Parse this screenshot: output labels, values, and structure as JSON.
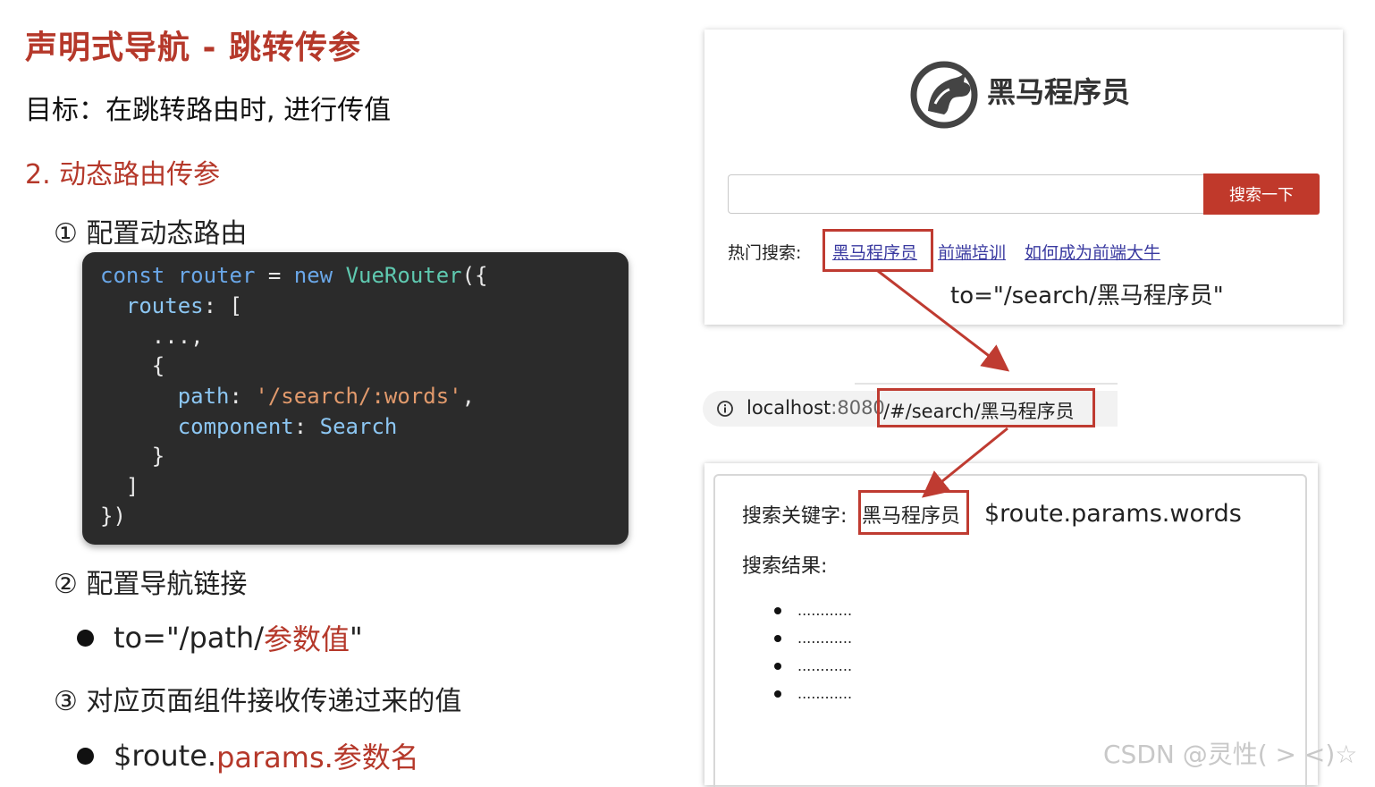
{
  "slide": {
    "title": "声明式导航 - 跳转传参",
    "goal": "目标：在跳转路由时, 进行传值",
    "section": "2.  动态路由传参",
    "step1": "① 配置动态路由",
    "step2": "② 配置导航链接",
    "step3": "③ 对应页面组件接收传递过来的值",
    "bullet1": {
      "prefix": "to=\"/path/",
      "highlight": "参数值",
      "suffix": "\""
    },
    "bullet2": {
      "prefix": "$route.",
      "highlight": "params.参数名"
    }
  },
  "code": {
    "line1": {
      "kw1": "const",
      "var": "router",
      "eq": " = ",
      "kw2": "new",
      "cls": "VueRouter",
      "tail": "({"
    },
    "line2": {
      "prop": "routes",
      "tail": ": ["
    },
    "line3": "...,",
    "line4": "{",
    "line5": {
      "prop": "path",
      "colon": ": ",
      "str": "'/search/:words'",
      "tail": ","
    },
    "line6": {
      "prop": "component",
      "colon": ": ",
      "val": "Search"
    },
    "line7": "}",
    "line8": "]",
    "line9": "})"
  },
  "browser": {
    "brand": "黑马程序员",
    "search_input_value": "",
    "search_button": "搜索一下",
    "hot_label": "热门搜索:",
    "hot_links": [
      "黑马程序员",
      "前端培训",
      "如何成为前端大牛"
    ],
    "to_annotation": "to=\"/search/黑马程序员\""
  },
  "address_bar": {
    "host": "localhost",
    "port": ":8080",
    "path": "/#/search/黑马程序员"
  },
  "result_page": {
    "keyword_label": "搜索关键字:",
    "keyword_value": "黑马程序员",
    "params_annotation": "$route.params.words",
    "results_label": "搜索结果:",
    "results": [
      "............",
      "............",
      "............",
      "............"
    ]
  },
  "watermark": "CSDN @灵性(  >  <)☆",
  "colors": {
    "accent": "#b5382a",
    "button": "#c0392b",
    "code_bg": "#2b2b2b",
    "link": "#3a3aa0"
  }
}
